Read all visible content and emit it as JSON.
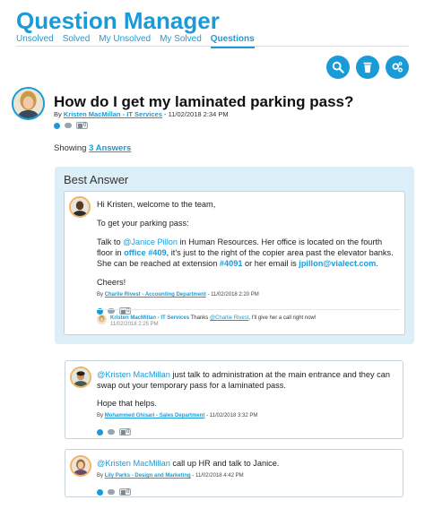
{
  "app": {
    "title": "Question Manager"
  },
  "tabs": [
    {
      "label": "Unsolved",
      "active": false
    },
    {
      "label": "Solved",
      "active": false
    },
    {
      "label": "My Unsolved",
      "active": false
    },
    {
      "label": "My Solved",
      "active": false
    },
    {
      "label": "Questions",
      "active": true
    }
  ],
  "colors": {
    "accent": "#1a9bd7",
    "best_bg": "#dceef8"
  },
  "actions": [
    "search-icon",
    "trash-icon",
    "settings-icon"
  ],
  "question": {
    "title": "How do I get my laminated parking pass?",
    "by": "By",
    "author": "Kristen MacMillan - IT Services",
    "date": "11/02/2018 2:34 PM",
    "likes": "0"
  },
  "showing": {
    "prefix": "Showing",
    "link": "3 Answers"
  },
  "best_answer": {
    "label": "Best Answer",
    "p1": "Hi Kristen, welcome to the team,",
    "p2": "To get your parking pass:",
    "p3_a": "Talk to ",
    "p3_mention": "@Janice Pillon",
    "p3_b": " in Human Resources. Her office is located on the fourth floor in ",
    "p3_office": "office #409",
    "p3_c": ", it's just to the right of the copier area past the elevator banks. She can be reached at extension ",
    "p3_ext": "#4091",
    "p3_d": " or her email is ",
    "p3_email": "jpillon@vialect.com",
    "p3_e": ".",
    "p4": "Cheers!",
    "by": "By",
    "author": "Charlie Rivest - Accounting Department",
    "date": "- 11/02/2018 2:20 PM",
    "likes": "0",
    "reply": {
      "author": "Kristen MacMillan - IT Services",
      "text_a": " Thanks ",
      "mention": "@Charlie Rivest",
      "text_b": ", I'll give her a call right now!",
      "date": "11/02/2018 2:25 PM"
    }
  },
  "comments": [
    {
      "mention": "@Kristen MacMillan",
      "text": " just talk to administration at the main entrance and they can swap out your temporary pass for a laminated pass.",
      "p2": "Hope that helps.",
      "by": "By",
      "author": "Mohammed Ghisari - Sales Department",
      "date": "- 11/02/2018 3:32 PM",
      "likes": "0"
    },
    {
      "mention": "@Kristen MacMillan",
      "text": " call up HR and talk to Janice.",
      "by": "By",
      "author": "Lily Parks - Design and Marketing",
      "date": "- 11/02/2018 4:42 PM",
      "likes": "0"
    }
  ]
}
